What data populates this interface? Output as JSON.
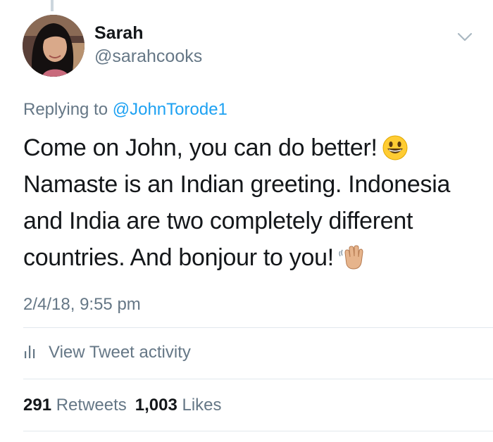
{
  "author": {
    "display_name": "Sarah",
    "handle": "@sarahcooks"
  },
  "reply": {
    "prefix": "Replying to",
    "mention": "@JohnTorode1"
  },
  "tweet": {
    "lines": [
      "Come on John, you can do better!",
      "Namaste is an Indian greeting. Indonesia",
      "and India are two completely different",
      "countries. And bonjour to you!"
    ],
    "emoji_1": "smiley-face-icon",
    "emoji_2": "waving-hand-icon"
  },
  "timestamp": "2/4/18, 9:55 pm",
  "activity": {
    "label": "View Tweet activity",
    "icon": "bar-chart-icon"
  },
  "stats": {
    "retweets_count": "291",
    "retweets_label": "Retweets",
    "likes_count": "1,003",
    "likes_label": "Likes"
  },
  "colors": {
    "text": "#14171a",
    "secondary": "#657786",
    "link": "#1da1f2",
    "divider": "#e1e8ed"
  }
}
